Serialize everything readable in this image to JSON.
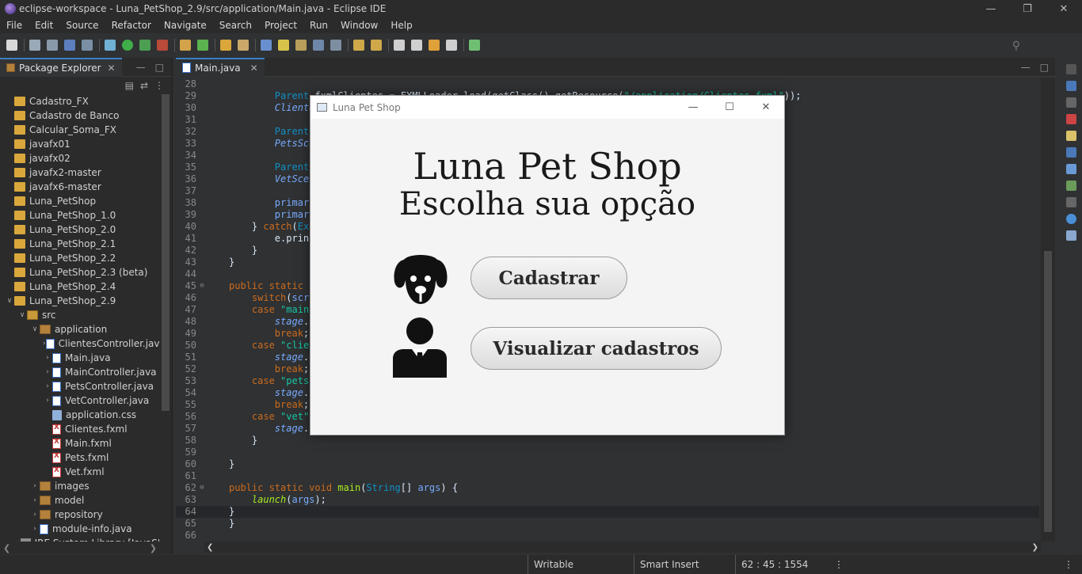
{
  "window": {
    "title": "eclipse-workspace - Luna_PetShop_2.9/src/application/Main.java - Eclipse IDE"
  },
  "menu": [
    "File",
    "Edit",
    "Source",
    "Refactor",
    "Navigate",
    "Search",
    "Project",
    "Run",
    "Window",
    "Help"
  ],
  "explorer": {
    "tab_label": "Package Explorer",
    "items": [
      {
        "label": "Cadastro_FX",
        "indent": 0,
        "icon": "project",
        "twisty": ""
      },
      {
        "label": "Cadastro de Banco",
        "indent": 0,
        "icon": "project",
        "twisty": ""
      },
      {
        "label": "Calcular_Soma_FX",
        "indent": 0,
        "icon": "project",
        "twisty": ""
      },
      {
        "label": "javafx01",
        "indent": 0,
        "icon": "project",
        "twisty": ""
      },
      {
        "label": "javafx02",
        "indent": 0,
        "icon": "project",
        "twisty": ""
      },
      {
        "label": "javafx2-master",
        "indent": 0,
        "icon": "project",
        "twisty": ""
      },
      {
        "label": "javafx6-master",
        "indent": 0,
        "icon": "project",
        "twisty": ""
      },
      {
        "label": "Luna_PetShop",
        "indent": 0,
        "icon": "project",
        "twisty": ""
      },
      {
        "label": "Luna_PetShop_1.0",
        "indent": 0,
        "icon": "project",
        "twisty": ""
      },
      {
        "label": "Luna_PetShop_2.0",
        "indent": 0,
        "icon": "project",
        "twisty": ""
      },
      {
        "label": "Luna_PetShop_2.1",
        "indent": 0,
        "icon": "project",
        "twisty": ""
      },
      {
        "label": "Luna_PetShop_2.2",
        "indent": 0,
        "icon": "project",
        "twisty": ""
      },
      {
        "label": "Luna_PetShop_2.3 (beta)",
        "indent": 0,
        "icon": "project",
        "twisty": ""
      },
      {
        "label": "Luna_PetShop_2.4",
        "indent": 0,
        "icon": "project",
        "twisty": ""
      },
      {
        "label": "Luna_PetShop_2.9",
        "indent": 0,
        "icon": "project",
        "twisty": "v"
      },
      {
        "label": "src",
        "indent": 1,
        "icon": "src",
        "twisty": "v"
      },
      {
        "label": "application",
        "indent": 2,
        "icon": "pkg",
        "twisty": "v"
      },
      {
        "label": "ClientesController.java",
        "indent": 3,
        "icon": "java",
        "twisty": ">"
      },
      {
        "label": "Main.java",
        "indent": 3,
        "icon": "java",
        "twisty": ">"
      },
      {
        "label": "MainController.java",
        "indent": 3,
        "icon": "java",
        "twisty": ">"
      },
      {
        "label": "PetsController.java",
        "indent": 3,
        "icon": "java",
        "twisty": ">"
      },
      {
        "label": "VetController.java",
        "indent": 3,
        "icon": "java",
        "twisty": ">"
      },
      {
        "label": "application.css",
        "indent": 3,
        "icon": "css",
        "twisty": ""
      },
      {
        "label": "Clientes.fxml",
        "indent": 3,
        "icon": "fxml",
        "twisty": ""
      },
      {
        "label": "Main.fxml",
        "indent": 3,
        "icon": "fxml",
        "twisty": ""
      },
      {
        "label": "Pets.fxml",
        "indent": 3,
        "icon": "fxml",
        "twisty": ""
      },
      {
        "label": "Vet.fxml",
        "indent": 3,
        "icon": "fxml",
        "twisty": ""
      },
      {
        "label": "images",
        "indent": 2,
        "icon": "pkg",
        "twisty": ">"
      },
      {
        "label": "model",
        "indent": 2,
        "icon": "pkg",
        "twisty": ">"
      },
      {
        "label": "repository",
        "indent": 2,
        "icon": "pkg",
        "twisty": ">"
      },
      {
        "label": "module-info.java",
        "indent": 2,
        "icon": "java",
        "twisty": ">"
      },
      {
        "label": "JRE System Library [JavaSE-...]",
        "indent": 1,
        "icon": "lib",
        "twisty": ">"
      }
    ]
  },
  "editor": {
    "tab_label": "Main.java",
    "lines": [
      {
        "n": "28",
        "html": ""
      },
      {
        "n": "29",
        "html": "        <span class=\"typ\">Parent</span> fxmlClientes = FXMLLoader.load(getClass().getResource(<span class=\"str\">\"/application/Clientes.fxml\"</span>));"
      },
      {
        "n": "30",
        "html": "        <span class=\"var ital\">ClientesScene</span> = <span class=\"kw\">new</span> Scene(fxmlClientes);"
      },
      {
        "n": "31",
        "html": ""
      },
      {
        "n": "32",
        "html": "        <span class=\"typ\">Parent</span> fxmlPets"
      },
      {
        "n": "33",
        "html": "        <span class=\"var ital\">PetsScene</span>"
      },
      {
        "n": "34",
        "html": ""
      },
      {
        "n": "35",
        "html": "        <span class=\"typ\">Parent</span> fxmlVet"
      },
      {
        "n": "36",
        "html": "        <span class=\"var ital\">VetScene</span>"
      },
      {
        "n": "37",
        "html": ""
      },
      {
        "n": "38",
        "html": "        <span class=\"var\">primaryStage</span>"
      },
      {
        "n": "39",
        "html": "        <span class=\"var\">primaryStage</span>"
      },
      {
        "n": "40",
        "html": "    } <span class=\"kw\">catch</span>(<span class=\"typ\">Exception</span> e)"
      },
      {
        "n": "41",
        "html": "        e.printStackTrace();"
      },
      {
        "n": "42",
        "html": "    }"
      },
      {
        "n": "43",
        "html": "}"
      },
      {
        "n": "44",
        "html": ""
      },
      {
        "n": "45",
        "html": "<span class=\"kw\">public static void</span> changeScreen(<span class=\"typ\">String</span> <span class=\"var\">scr</span>)",
        "fold": "⊖"
      },
      {
        "n": "46",
        "html": "    <span class=\"kw\">switch</span>(<span class=\"var\">scr</span>) {"
      },
      {
        "n": "47",
        "html": "    <span class=\"kw\">case</span> <span class=\"str\">\"main\"</span>:"
      },
      {
        "n": "48",
        "html": "        <span class=\"var ital\">stage</span>.setScene"
      },
      {
        "n": "49",
        "html": "        <span class=\"kw\">break</span>;"
      },
      {
        "n": "50",
        "html": "    <span class=\"kw\">case</span> <span class=\"str\">\"clientes\"</span>:"
      },
      {
        "n": "51",
        "html": "        <span class=\"var ital\">stage</span>.setScene"
      },
      {
        "n": "52",
        "html": "        <span class=\"kw\">break</span>;"
      },
      {
        "n": "53",
        "html": "    <span class=\"kw\">case</span> <span class=\"str\">\"pets\"</span>:"
      },
      {
        "n": "54",
        "html": "        <span class=\"var ital\">stage</span>.setScene"
      },
      {
        "n": "55",
        "html": "        <span class=\"kw\">break</span>;"
      },
      {
        "n": "56",
        "html": "    <span class=\"kw\">case</span> <span class=\"str\">\"vet\"</span>:"
      },
      {
        "n": "57",
        "html": "        <span class=\"var ital\">stage</span>.setScene"
      },
      {
        "n": "58",
        "html": "    }"
      },
      {
        "n": "59",
        "html": ""
      },
      {
        "n": "60",
        "html": "}"
      },
      {
        "n": "61",
        "html": ""
      },
      {
        "n": "62",
        "html": "<span class=\"kw\">public static void</span> <span class=\"fn\" style=\"font-style:normal\">main</span>(<span class=\"typ\">String</span>[] <span class=\"var\">args</span>) {",
        "fold": "⊖"
      },
      {
        "n": "63",
        "html": "    <span class=\"fn\">launch</span>(<span class=\"var\">args</span>);"
      },
      {
        "n": "64",
        "html": "}",
        "current": true
      },
      {
        "n": "65",
        "html": "}"
      },
      {
        "n": "66",
        "html": ""
      }
    ]
  },
  "status": {
    "writable": "Writable",
    "insert_mode": "Smart Insert",
    "position": "62 : 45 : 1554"
  },
  "fx_window": {
    "title": "Luna Pet Shop",
    "heading": "Luna Pet Shop",
    "subheading": "Escolha sua opção",
    "btn_cadastrar": "Cadastrar",
    "btn_visualizar": "Visualizar cadastros"
  }
}
